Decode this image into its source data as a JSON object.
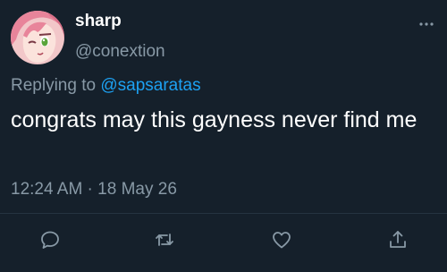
{
  "user": {
    "display_name": "sharp",
    "handle": "@conextion"
  },
  "reply": {
    "prefix": "Replying to",
    "mention": "@sapsaratas"
  },
  "tweet": {
    "text": "congrats may this gayness never find me",
    "timestamp": "12:24 AM · 18 May 26"
  },
  "icons": {
    "more": "more-horizontal-icon",
    "reply": "reply-icon",
    "retweet": "retweet-icon",
    "like": "heart-icon",
    "share": "share-icon"
  },
  "colors": {
    "background": "#15202b",
    "text": "#ffffff",
    "muted": "#8899a6",
    "accent": "#1da1f2"
  }
}
